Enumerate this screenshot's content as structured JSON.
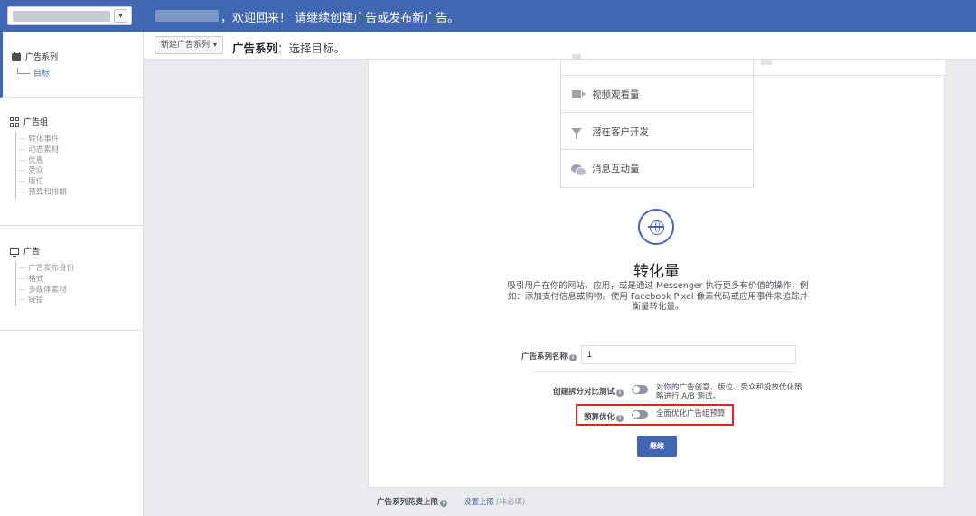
{
  "topbar": {
    "banner_text": "，欢迎回来！ 请继续创建广告或",
    "banner_link": "发布新广告",
    "banner_end": "。",
    "account_dropdown_glyph": "▾",
    "color": "#4267b2"
  },
  "header": {
    "create_button": "新建广告系列",
    "create_button_caret": "▾",
    "title": "广告系列",
    "subtitle": "：选择目标。"
  },
  "sidebar": {
    "campaign": {
      "label": "广告系列",
      "sub": "目标"
    },
    "adset": {
      "label": "广告组",
      "items": [
        "转化事件",
        "动态素材",
        "优惠",
        "受众",
        "版位",
        "预算和排期"
      ]
    },
    "ad": {
      "label": "广告",
      "items": [
        "广告发布身份",
        "格式",
        "多媒体素材",
        "链接"
      ]
    }
  },
  "objectives": [
    {
      "label": "视频观看量",
      "icon": "video-icon"
    },
    {
      "label": "潜在客户开发",
      "icon": "funnel-icon"
    },
    {
      "label": "消息互动量",
      "icon": "chat-bubble-icon"
    }
  ],
  "selected_objective": {
    "title": "转化量",
    "description": "吸引用户在你的网站、应用，或是通过 Messenger 执行更多有价值的操作，例如：添加支付信息或购物。使用 Facebook Pixel 像素代码或应用事件来追踪并衡量转化量。",
    "icon": "globe-icon"
  },
  "form": {
    "name_label": "广告系列名称",
    "name_value": "1",
    "split_label": "创建拆分对比测试",
    "split_desc": "对你的广告创意、版位、受众和投放优化策略进行 A/B 测试。",
    "split_on": false,
    "cbo_label": "预算优化",
    "cbo_desc": "全面优化广告组预算",
    "cbo_on": false,
    "info_glyph": "i",
    "continue": "继续"
  },
  "footer": {
    "label": "广告系列花费上限",
    "link": "设置上限",
    "optional": "(非必填)"
  },
  "colors": {
    "highlight_box": "#d82727",
    "primary": "#4267b2"
  }
}
